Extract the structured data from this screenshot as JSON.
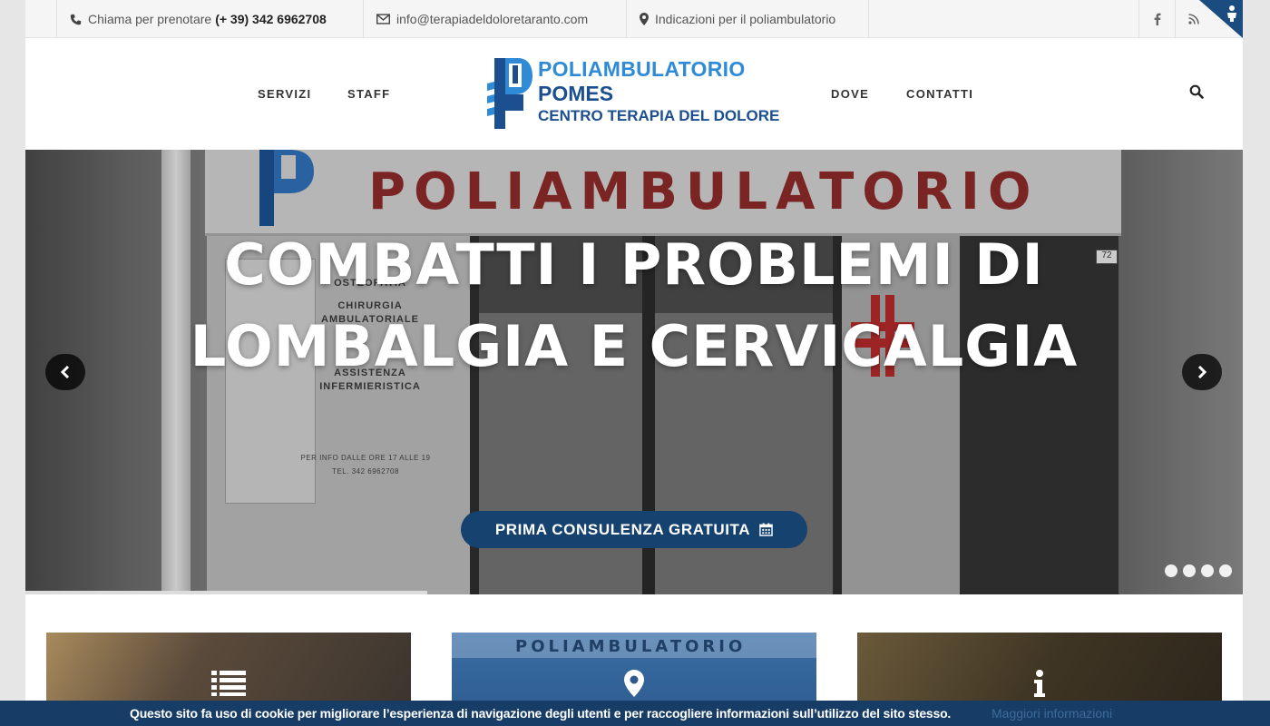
{
  "topbar": {
    "phone_label": "Chiama per prenotare",
    "phone_number": "(+ 39) 342 6962708",
    "email": "info@terapiadeldoloretaranto.com",
    "directions": "Indicazioni per il poliambulatorio",
    "social": [
      "facebook-icon",
      "rss-icon"
    ]
  },
  "nav": {
    "items": [
      "SERVIZI",
      "STAFF",
      "DOVE",
      "CONTATTI"
    ]
  },
  "logo": {
    "line1": "POLIAMBULATORIO",
    "line2": "POMES",
    "line3": "CENTRO TERAPIA DEL DOLORE"
  },
  "slider": {
    "sign_text": "POLIAMBULATORIO",
    "headline_line1": "COMBATTI I PROBLEMI DI",
    "headline_line2": "LOMBALGIA E CERVICALGIA",
    "cta_label": "PRIMA CONSULENZA GRATUITA",
    "facade_list": [
      "OSTEOPATIA",
      "CHIRURGIA",
      "AMBULATORIALE",
      "ASSISTENZA",
      "INFERMIERISTICA"
    ],
    "facade_info": "PER INFO DALLE ORE 17 ALLE 19",
    "facade_tel": "TEL. 342 6962708",
    "house_number": "72",
    "slide_count": 4,
    "progress_fraction": 0.33
  },
  "cards": [
    {
      "icon": "list-icon"
    },
    {
      "icon": "map-marker-icon",
      "sign": "POLIAMBULATORIO"
    },
    {
      "icon": "info-icon"
    }
  ],
  "cookie": {
    "message": "Questo sito fa uso di cookie per migliorare l’esperienza di navigazione degli utenti e per raccogliere informazioni sull’utilizzo del sito stesso.",
    "more_label": "Maggiori informazioni"
  },
  "colors": {
    "brand_dark": "#16426f",
    "brand_light": "#2f8bd6",
    "cookie_bar": "#173d66"
  }
}
